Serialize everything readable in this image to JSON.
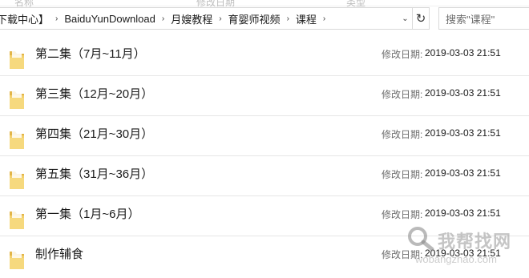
{
  "ribbon": {
    "col1": "名称",
    "col2": "修改日期",
    "col3": "类型"
  },
  "address": {
    "crumbs": [
      "下载中心】",
      "BaiduYunDownload",
      "月嫂教程",
      "育婴师视频",
      "课程"
    ],
    "separator": "›",
    "dropdown": "⌄",
    "refresh": "↻"
  },
  "search": {
    "placeholder": "搜索\"课程\""
  },
  "files": [
    {
      "name": "第二集（7月~11月）",
      "date_label": "修改日期:",
      "date": "2019-03-03 21:51"
    },
    {
      "name": "第三集（12月~20月）",
      "date_label": "修改日期:",
      "date": "2019-03-03 21:51"
    },
    {
      "name": "第四集（21月~30月）",
      "date_label": "修改日期:",
      "date": "2019-03-03 21:51"
    },
    {
      "name": "第五集（31月~36月）",
      "date_label": "修改日期:",
      "date": "2019-03-03 21:51"
    },
    {
      "name": "第一集（1月~6月）",
      "date_label": "修改日期:",
      "date": "2019-03-03 21:51"
    },
    {
      "name": "制作辅食",
      "date_label": "修改日期:",
      "date": "2019-03-03 21:51"
    }
  ],
  "watermark": {
    "cn": "我帮找网",
    "en": "wobangzhao.com"
  },
  "colors": {
    "folder": "#f3cf6a",
    "folder_dark": "#e2b548",
    "row_border": "#e6e6e6"
  }
}
